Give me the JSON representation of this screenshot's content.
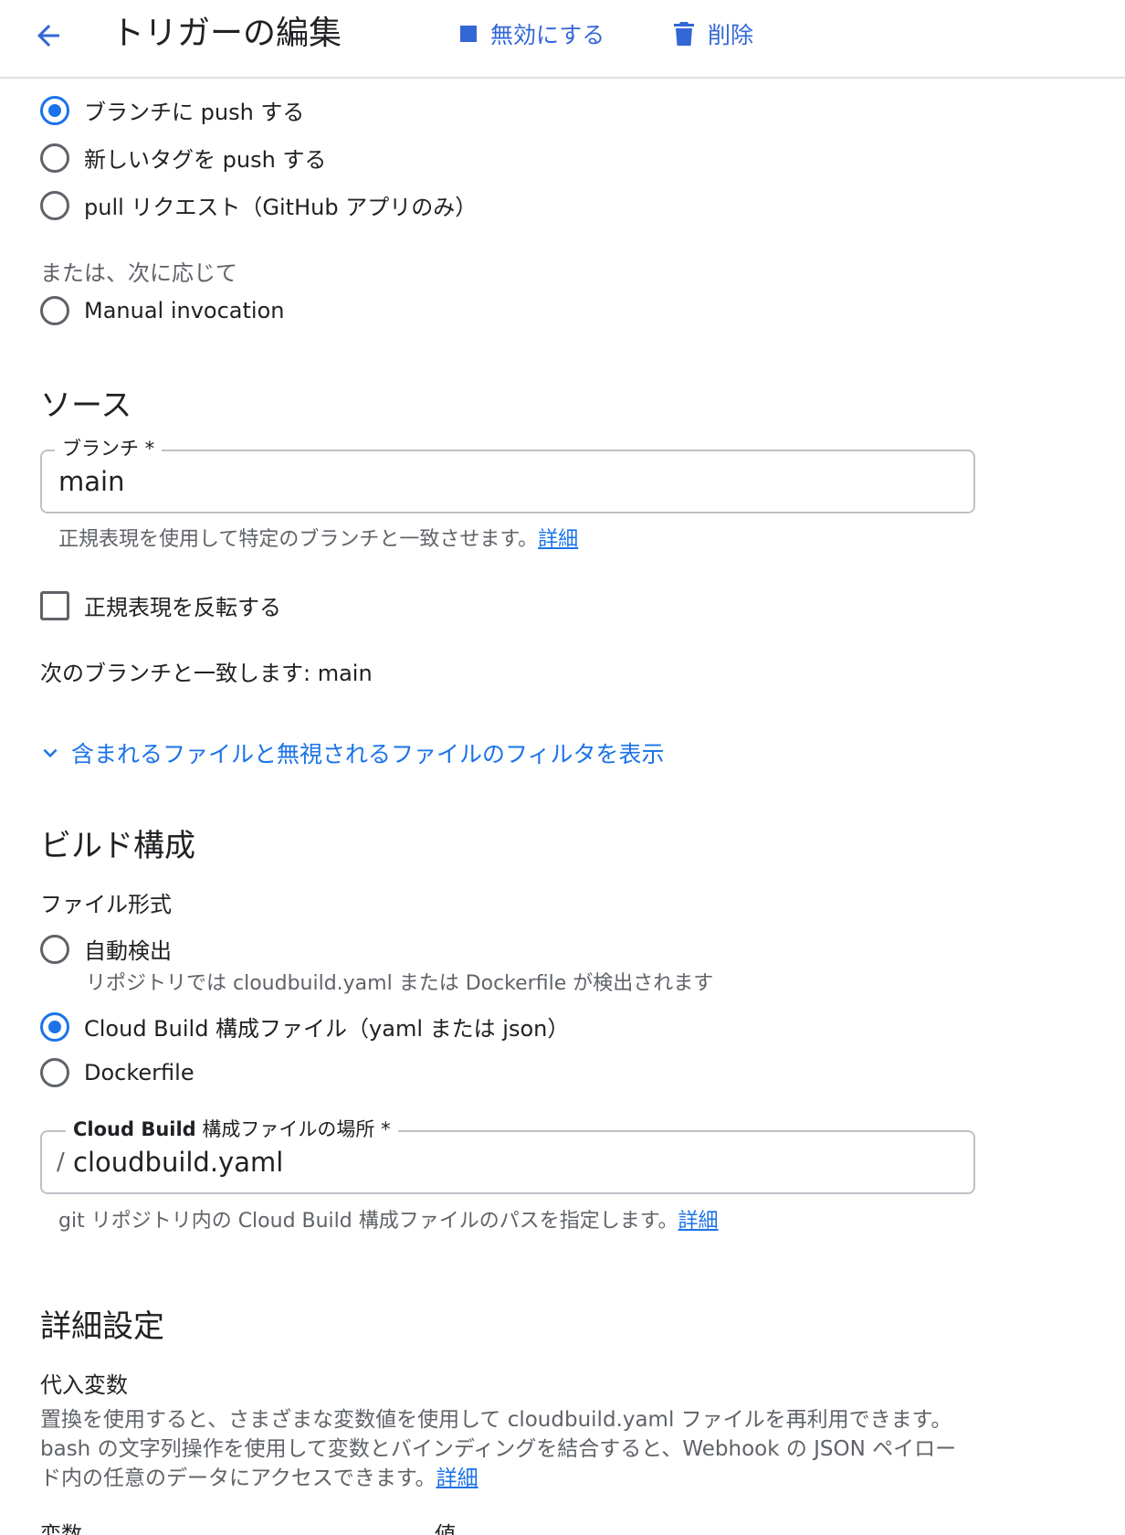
{
  "header": {
    "title": "トリガーの編集",
    "disable_label": "無効にする",
    "delete_label": "削除"
  },
  "event": {
    "options": [
      {
        "label": "ブランチに push する",
        "checked": true
      },
      {
        "label": "新しいタグを push する",
        "checked": false
      },
      {
        "label": "pull リクエスト（GitHub アプリのみ）",
        "checked": false
      }
    ],
    "or_label": "または、次に応じて",
    "manual_label": "Manual invocation"
  },
  "source": {
    "title": "ソース",
    "branch_label": "ブランチ *",
    "branch_value": "main",
    "branch_helper": "正規表現を使用して特定のブランチと一致させます。",
    "details_link": "詳細",
    "invert_label": "正規表現を反転する",
    "matches_text": "次のブランチと一致します: main",
    "filters_toggle": "含まれるファイルと無視されるファイルのフィルタを表示"
  },
  "build_config": {
    "title": "ビルド構成",
    "file_type_label": "ファイル形式",
    "options": [
      {
        "label": "自動検出",
        "checked": false,
        "sub": "リポジトリでは cloudbuild.yaml または Dockerfile が検出されます"
      },
      {
        "label": "Cloud Build 構成ファイル（yaml または json）",
        "checked": true
      },
      {
        "label": "Dockerfile",
        "checked": false
      }
    ],
    "location_label_bold": "Cloud Build",
    "location_label_rest": " 構成ファイルの場所 *",
    "location_prefix": "/",
    "location_value": "cloudbuild.yaml",
    "location_helper": "git リポジトリ内の Cloud Build 構成ファイルのパスを指定します。",
    "details_link": "詳細"
  },
  "advanced": {
    "title": "詳細設定",
    "subs_title": "代入変数",
    "subs_desc": "置換を使用すると、さまざまな変数値を使用して cloudbuild.yaml ファイルを再利用できます。bash の文字列操作を使用して変数とバインディングを結合すると、Webhook の JSON ペイロード内の任意のデータにアクセスできます。",
    "details_link": "詳細",
    "col_variable": "変数",
    "col_value": "値"
  },
  "icons": {
    "back": "arrow-back-icon",
    "disable": "stop-square-icon",
    "delete": "trash-icon",
    "expand": "chevron-down-icon"
  },
  "colors": {
    "accent": "#1a73e8",
    "header_action": "#3367d6",
    "text": "#202124",
    "muted": "#5f6368"
  }
}
